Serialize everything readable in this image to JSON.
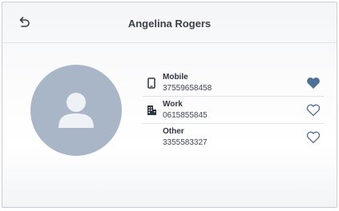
{
  "header": {
    "title": "Angelina Rogers"
  },
  "contact": {
    "phones": [
      {
        "label": "Mobile",
        "number": "37559658458",
        "favorite": true,
        "icon": "mobile-phone-icon"
      },
      {
        "label": "Work",
        "number": "0615855845",
        "favorite": false,
        "icon": "office-building-icon"
      },
      {
        "label": "Other",
        "number": "3355583327",
        "favorite": false,
        "icon": ""
      }
    ]
  },
  "colors": {
    "accent": "#4f6f96",
    "avatar_bg": "#a8b6c8",
    "avatar_fg": "#eef1f5"
  }
}
